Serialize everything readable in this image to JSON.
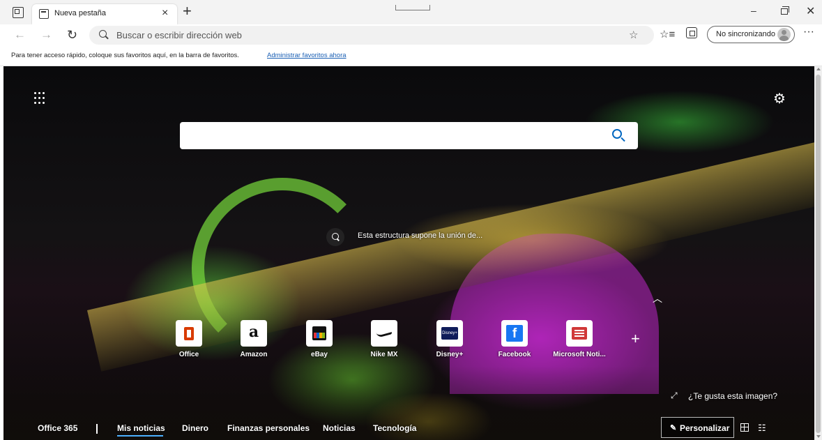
{
  "tab": {
    "title": "Nueva pestaña",
    "close_glyph": "×",
    "new_tab_glyph": "+"
  },
  "window": {
    "minimize_glyph": "–",
    "close_glyph": "✕"
  },
  "toolbar": {
    "back_glyph": "←",
    "forward_glyph": "→",
    "refresh_glyph": "↻",
    "address_placeholder": "Buscar o escribir dirección web",
    "add_favorite_glyph": "☆",
    "favorites_glyph": "☆≡",
    "profile_label": "No sincronizando",
    "more_glyph": "···"
  },
  "favorites_bar": {
    "text": "Para tener acceso rápido, coloque sus favoritos aquí, en la barra de favoritos.",
    "link": "Administrar favoritos ahora"
  },
  "new_tab_page": {
    "settings_glyph": "⚙",
    "image_caption": "Esta estructura supone la unión de...",
    "collapse_glyph": "︿",
    "add_site_glyph": "+",
    "like_image_glyph": "⤢",
    "like_image_text": "¿Te gusta esta imagen?",
    "quick_links": [
      {
        "label": "Office",
        "icon": "office-icon"
      },
      {
        "label": "Amazon",
        "icon": "amazon-icon",
        "glyph": "a"
      },
      {
        "label": "eBay",
        "icon": "ebay-icon"
      },
      {
        "label": "Nike MX",
        "icon": "nike-icon"
      },
      {
        "label": "Disney+",
        "icon": "disney-icon",
        "glyph": "Disney+"
      },
      {
        "label": "Facebook",
        "icon": "facebook-icon",
        "glyph": "f"
      },
      {
        "label": "Microsoft Noti...",
        "icon": "msn-icon"
      }
    ],
    "news_tabs": {
      "office365": "Office 365",
      "separator": "|",
      "mis_noticias": "Mis noticias",
      "dinero": "Dinero",
      "finanzas": "Finanzas personales",
      "noticias": "Noticias",
      "tecnologia": "Tecnología"
    },
    "personalize_label": "Personalizar",
    "personalize_glyph": "✎",
    "list_layout_glyph": "☷"
  },
  "colors": {
    "accent": "#0067c0",
    "active_tab_underline": "#4cb0ff",
    "link": "#1a5fb4"
  }
}
